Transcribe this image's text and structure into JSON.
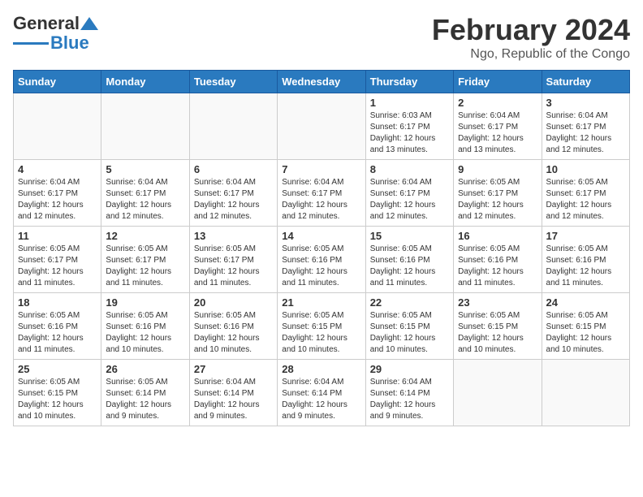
{
  "logo": {
    "general": "General",
    "blue": "Blue"
  },
  "header": {
    "title": "February 2024",
    "subtitle": "Ngo, Republic of the Congo"
  },
  "weekdays": [
    "Sunday",
    "Monday",
    "Tuesday",
    "Wednesday",
    "Thursday",
    "Friday",
    "Saturday"
  ],
  "rows": [
    [
      {
        "day": "",
        "info": ""
      },
      {
        "day": "",
        "info": ""
      },
      {
        "day": "",
        "info": ""
      },
      {
        "day": "",
        "info": ""
      },
      {
        "day": "1",
        "info": "Sunrise: 6:03 AM\nSunset: 6:17 PM\nDaylight: 12 hours\nand 13 minutes."
      },
      {
        "day": "2",
        "info": "Sunrise: 6:04 AM\nSunset: 6:17 PM\nDaylight: 12 hours\nand 13 minutes."
      },
      {
        "day": "3",
        "info": "Sunrise: 6:04 AM\nSunset: 6:17 PM\nDaylight: 12 hours\nand 12 minutes."
      }
    ],
    [
      {
        "day": "4",
        "info": "Sunrise: 6:04 AM\nSunset: 6:17 PM\nDaylight: 12 hours\nand 12 minutes."
      },
      {
        "day": "5",
        "info": "Sunrise: 6:04 AM\nSunset: 6:17 PM\nDaylight: 12 hours\nand 12 minutes."
      },
      {
        "day": "6",
        "info": "Sunrise: 6:04 AM\nSunset: 6:17 PM\nDaylight: 12 hours\nand 12 minutes."
      },
      {
        "day": "7",
        "info": "Sunrise: 6:04 AM\nSunset: 6:17 PM\nDaylight: 12 hours\nand 12 minutes."
      },
      {
        "day": "8",
        "info": "Sunrise: 6:04 AM\nSunset: 6:17 PM\nDaylight: 12 hours\nand 12 minutes."
      },
      {
        "day": "9",
        "info": "Sunrise: 6:05 AM\nSunset: 6:17 PM\nDaylight: 12 hours\nand 12 minutes."
      },
      {
        "day": "10",
        "info": "Sunrise: 6:05 AM\nSunset: 6:17 PM\nDaylight: 12 hours\nand 12 minutes."
      }
    ],
    [
      {
        "day": "11",
        "info": "Sunrise: 6:05 AM\nSunset: 6:17 PM\nDaylight: 12 hours\nand 11 minutes."
      },
      {
        "day": "12",
        "info": "Sunrise: 6:05 AM\nSunset: 6:17 PM\nDaylight: 12 hours\nand 11 minutes."
      },
      {
        "day": "13",
        "info": "Sunrise: 6:05 AM\nSunset: 6:17 PM\nDaylight: 12 hours\nand 11 minutes."
      },
      {
        "day": "14",
        "info": "Sunrise: 6:05 AM\nSunset: 6:16 PM\nDaylight: 12 hours\nand 11 minutes."
      },
      {
        "day": "15",
        "info": "Sunrise: 6:05 AM\nSunset: 6:16 PM\nDaylight: 12 hours\nand 11 minutes."
      },
      {
        "day": "16",
        "info": "Sunrise: 6:05 AM\nSunset: 6:16 PM\nDaylight: 12 hours\nand 11 minutes."
      },
      {
        "day": "17",
        "info": "Sunrise: 6:05 AM\nSunset: 6:16 PM\nDaylight: 12 hours\nand 11 minutes."
      }
    ],
    [
      {
        "day": "18",
        "info": "Sunrise: 6:05 AM\nSunset: 6:16 PM\nDaylight: 12 hours\nand 11 minutes."
      },
      {
        "day": "19",
        "info": "Sunrise: 6:05 AM\nSunset: 6:16 PM\nDaylight: 12 hours\nand 10 minutes."
      },
      {
        "day": "20",
        "info": "Sunrise: 6:05 AM\nSunset: 6:16 PM\nDaylight: 12 hours\nand 10 minutes."
      },
      {
        "day": "21",
        "info": "Sunrise: 6:05 AM\nSunset: 6:15 PM\nDaylight: 12 hours\nand 10 minutes."
      },
      {
        "day": "22",
        "info": "Sunrise: 6:05 AM\nSunset: 6:15 PM\nDaylight: 12 hours\nand 10 minutes."
      },
      {
        "day": "23",
        "info": "Sunrise: 6:05 AM\nSunset: 6:15 PM\nDaylight: 12 hours\nand 10 minutes."
      },
      {
        "day": "24",
        "info": "Sunrise: 6:05 AM\nSunset: 6:15 PM\nDaylight: 12 hours\nand 10 minutes."
      }
    ],
    [
      {
        "day": "25",
        "info": "Sunrise: 6:05 AM\nSunset: 6:15 PM\nDaylight: 12 hours\nand 10 minutes."
      },
      {
        "day": "26",
        "info": "Sunrise: 6:05 AM\nSunset: 6:14 PM\nDaylight: 12 hours\nand 9 minutes."
      },
      {
        "day": "27",
        "info": "Sunrise: 6:04 AM\nSunset: 6:14 PM\nDaylight: 12 hours\nand 9 minutes."
      },
      {
        "day": "28",
        "info": "Sunrise: 6:04 AM\nSunset: 6:14 PM\nDaylight: 12 hours\nand 9 minutes."
      },
      {
        "day": "29",
        "info": "Sunrise: 6:04 AM\nSunset: 6:14 PM\nDaylight: 12 hours\nand 9 minutes."
      },
      {
        "day": "",
        "info": ""
      },
      {
        "day": "",
        "info": ""
      }
    ]
  ]
}
